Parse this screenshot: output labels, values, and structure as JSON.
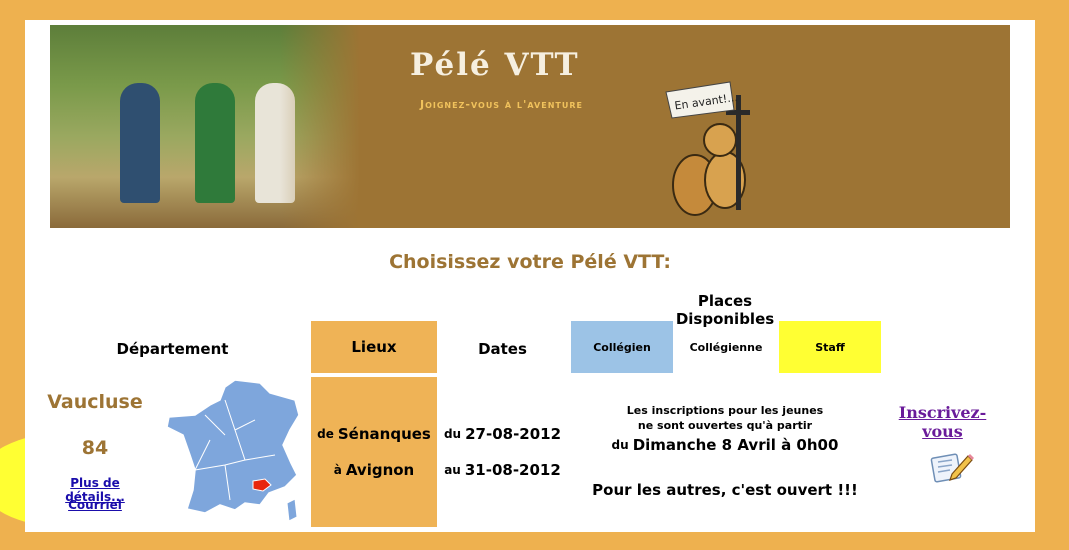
{
  "banner": {
    "title": "Pélé VTT",
    "subtitle": "Joignez-vous à l'aventure",
    "flag_text": "En avant!..."
  },
  "heading": "Choisissez votre Pélé VTT:",
  "table": {
    "places_title": "Places Disponibles",
    "headers": {
      "departement": "Département",
      "lieux": "Lieux",
      "dates": "Dates",
      "collegien": "Collégien",
      "collegienne": "Collégienne",
      "staff": "Staff"
    },
    "row": {
      "departement_name": "Vaucluse",
      "departement_number": "84",
      "details_link": "Plus de détails...",
      "mail_link": "Courriel",
      "lieu_from_prefix": "de",
      "lieu_from": "Sénanques",
      "lieu_to_prefix": "à",
      "lieu_to": "Avignon",
      "date_from_prefix": "du",
      "date_from": "27-08-2012",
      "date_to_prefix": "au",
      "date_to": "31-08-2012",
      "inscription_line1": "Les inscriptions pour les jeunes",
      "inscription_line2": "ne sont ouvertes qu'à partir",
      "inscription_line3_prefix": "du",
      "inscription_line3": "Dimanche 8 Avril à 0h00",
      "others_open": "Pour les autres, c'est ouvert !!!",
      "register_link": "Inscrivez-vous"
    }
  },
  "colors": {
    "background": "#eeb14f",
    "banner": "#9d7434",
    "lieux_cell": "#efb356",
    "collegien_cell": "#9cc3e6",
    "staff_cell": "#ffff33",
    "map_blue": "#7ea6dc",
    "map_red": "#e8250c",
    "highlight": "#ffff33"
  }
}
